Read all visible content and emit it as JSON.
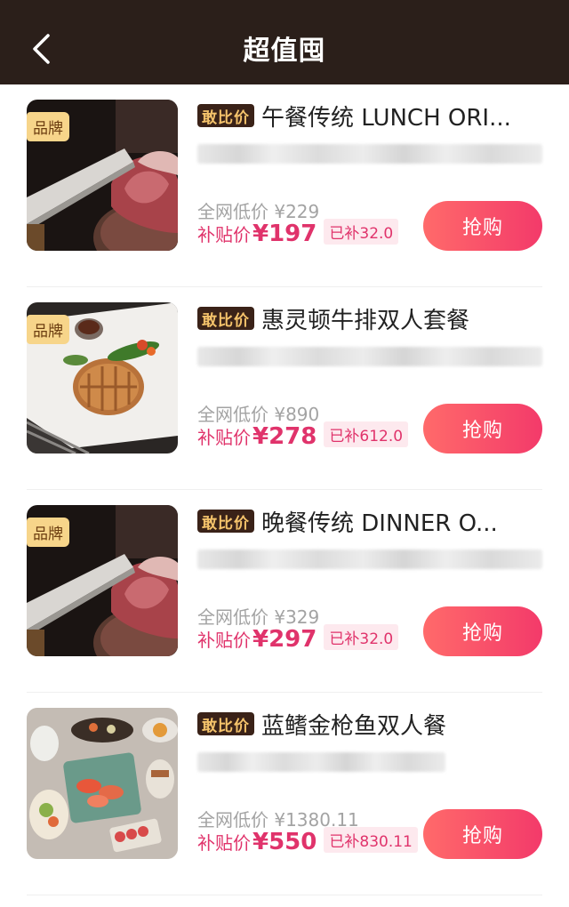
{
  "header": {
    "title": "超值囤",
    "back_icon": "chevron-left-icon"
  },
  "items": [
    {
      "brand": "品牌",
      "tag": "敢比价",
      "title": "午餐传统 LUNCH ORI...",
      "orig_price": "全网低价 ¥229",
      "sub_label": "补贴价",
      "sub_price": "¥197",
      "sub_chip": "已补32.0",
      "buy": "抢购",
      "image": "beef-carving"
    },
    {
      "brand": "品牌",
      "tag": "敢比价",
      "title": "惠灵顿牛排双人套餐",
      "orig_price": "全网低价 ¥890",
      "sub_label": "补贴价",
      "sub_price": "¥278",
      "sub_chip": "已补612.0",
      "buy": "抢购",
      "image": "wellington-plate"
    },
    {
      "brand": "品牌",
      "tag": "敢比价",
      "title": "晚餐传统  DINNER O...",
      "orig_price": "全网低价 ¥329",
      "sub_label": "补贴价",
      "sub_price": "¥297",
      "sub_chip": "已补32.0",
      "buy": "抢购",
      "image": "beef-carving"
    },
    {
      "brand": "",
      "tag": "敢比价",
      "title": "蓝鳍金枪鱼双人餐",
      "orig_price": "全网低价 ¥1380.11",
      "sub_label": "补贴价",
      "sub_price": "¥550",
      "sub_chip": "已补830.11",
      "buy": "抢购",
      "image": "sashimi-spread"
    }
  ],
  "colors": {
    "header_bg": "#2b1f1a",
    "accent_pink": "#e0336b",
    "brand_badge": "#f7d58a",
    "tag_bg": "#3a2218",
    "tag_text": "#f5c36b"
  }
}
